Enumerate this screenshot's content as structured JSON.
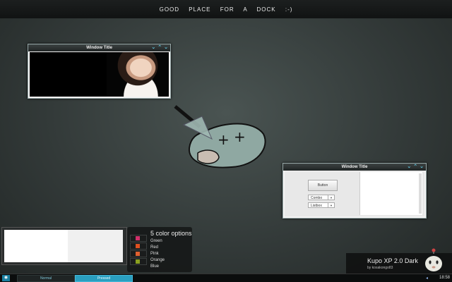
{
  "dock": {
    "text": "GOOD PLACE FOR A DOCK :-)"
  },
  "window1": {
    "title": "Window Title",
    "controls": [
      "⌄",
      "⌃",
      "⌄"
    ]
  },
  "window2": {
    "title": "Window Title",
    "controls": [
      "⌄",
      "⌃",
      "⌄"
    ],
    "button_label": "Button",
    "combo_label": "Combo",
    "listbox_label": "Listbox"
  },
  "color_options": {
    "heading": "5 color options",
    "items": [
      {
        "label": "Green",
        "color": "#d0306a"
      },
      {
        "label": "Red",
        "color": "#e05020"
      },
      {
        "label": "Pink",
        "color": "#e06030"
      },
      {
        "label": "Orange",
        "color": "#e07a20"
      },
      {
        "label": "Blue",
        "color": "#8aa020"
      }
    ]
  },
  "branding": {
    "title": "Kupo XP 2.0 Dark",
    "subtitle": "by kosakongo83"
  },
  "taskbar": {
    "normal_label": "Normal",
    "pressed_label": "Pressed",
    "clock": "18:58",
    "accent": "#2a9fc0"
  }
}
